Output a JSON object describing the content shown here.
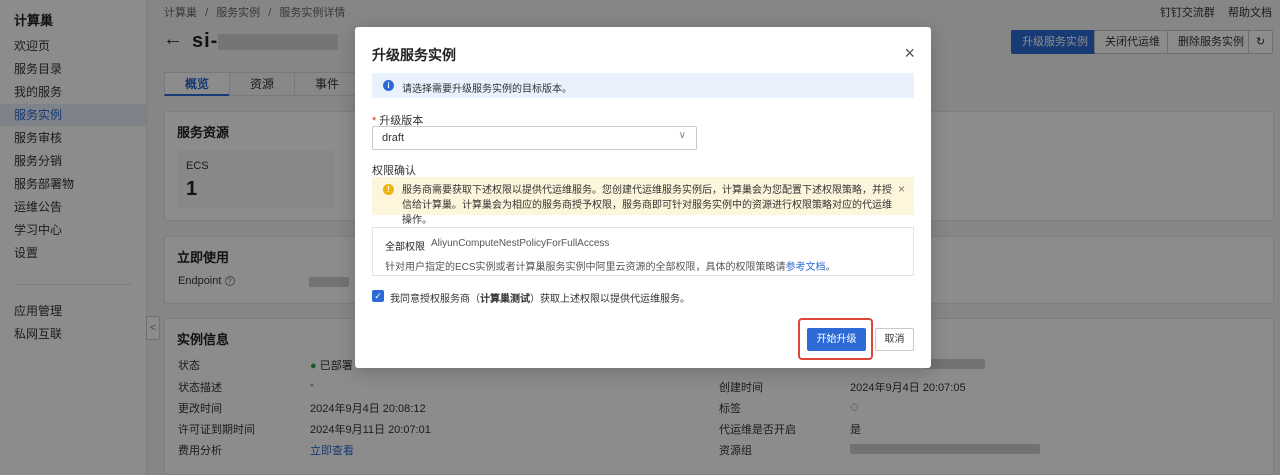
{
  "sidebar": {
    "title": "计算巢",
    "items": [
      "欢迎页",
      "服务目录",
      "我的服务",
      "服务实例",
      "服务审核",
      "服务分销",
      "服务部署物",
      "运维公告",
      "学习中心",
      "设置"
    ],
    "items2": [
      "应用管理",
      "私网互联"
    ],
    "collapse": "<"
  },
  "breadcrumb": [
    "计算巢",
    "/",
    "服务实例",
    "/",
    "服务实例详情"
  ],
  "top_links": {
    "dingtalk": "钉钉交流群",
    "help": "帮助文档"
  },
  "page": {
    "back": "←",
    "title_prefix": "si-",
    "buttons": {
      "upgrade": "升级服务实例",
      "close_ops": "关闭代运维",
      "delete": "删除服务实例",
      "refresh": "↻"
    }
  },
  "tabs": [
    "概览",
    "资源",
    "事件"
  ],
  "resources_card": {
    "title": "服务资源",
    "ecs_label": "ECS",
    "ecs_count": "1"
  },
  "use_card": {
    "title": "立即使用",
    "endpoint_label": "Endpoint",
    "help": "?"
  },
  "instance_card": {
    "title": "实例信息",
    "left": [
      {
        "label": "状态",
        "value": "已部署"
      },
      {
        "label": "状态描述",
        "value": "-"
      },
      {
        "label": "更改时间",
        "value": "2024年9月4日 20:08:12"
      },
      {
        "label": "许可证到期时间",
        "value": "2024年9月11日 20:07:01"
      },
      {
        "label": "费用分析",
        "value": "立即查看"
      }
    ],
    "right": [
      {
        "label": "创建时间",
        "value": "2024年9月4日 20:07:05"
      },
      {
        "label": "标签",
        "value": "◇"
      },
      {
        "label": "代运维是否开启",
        "value": "是"
      },
      {
        "label": "资源组",
        "value": ""
      }
    ]
  },
  "modal": {
    "title": "升级服务实例",
    "close": "×",
    "info_icon": "i",
    "info": "请选择需要升级服务实例的目标版本。",
    "version_label": "升级版本",
    "required_mark": "*",
    "version_value": "draft",
    "chevron": "∨",
    "perm_label": "权限确认",
    "warn_icon": "!",
    "warn_text": "服务商需要获取下述权限以提供代运维服务。您创建代运维服务实例后，计算巢会为您配置下述权限策略，并授信给计算巢。计算巢会为相应的服务商授予权限，服务商即可针对服务实例中的资源进行权限策略对应的代运维操作。",
    "warn_close": "×",
    "policy_name": "全部权限",
    "policy_id": "AliyunComputeNestPolicyForFullAccess",
    "policy_desc": "针对用户指定的ECS实例或者计算巢服务实例中阿里云资源的全部权限，具体的权限策略请",
    "policy_link": "参考文档",
    "policy_end": "。",
    "check": "✓",
    "agree_pre": "我同意授权服务商（",
    "agree_bold": "计算巢测试",
    "agree_post": "）获取上述权限以提供代运维服务。",
    "start_btn": "开始升级",
    "cancel_btn": "取消"
  }
}
